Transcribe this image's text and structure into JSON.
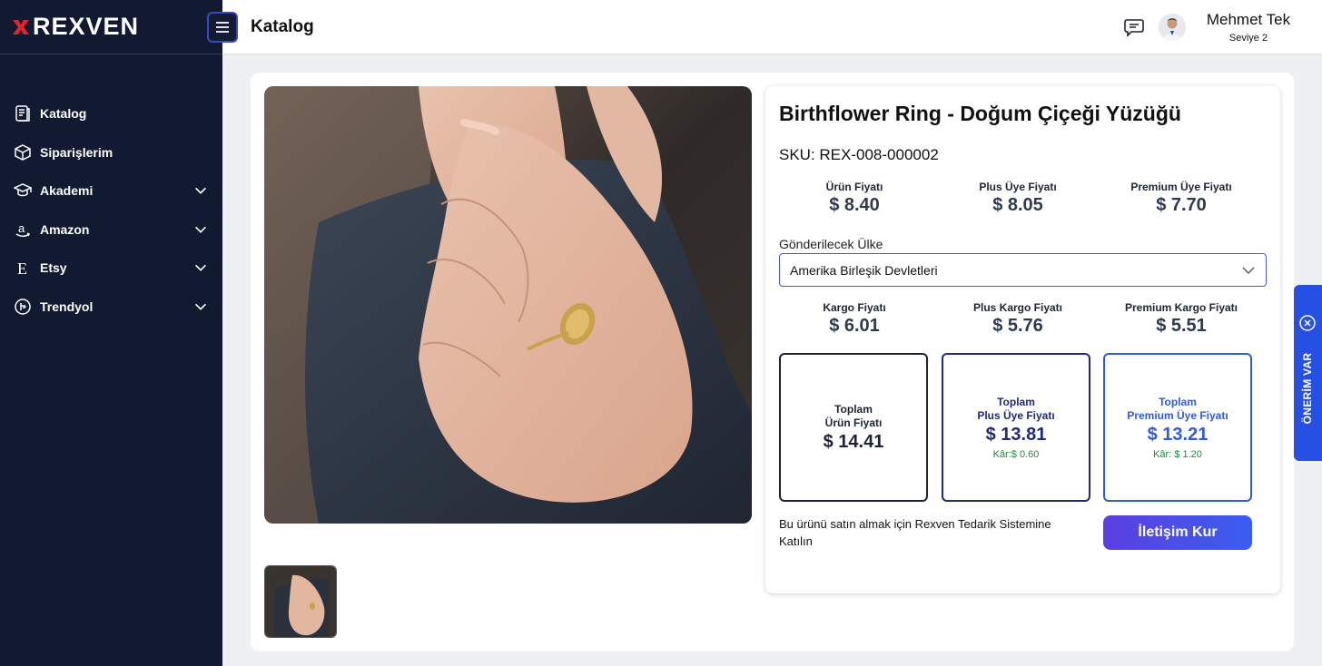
{
  "brand": {
    "name": "REXVEN"
  },
  "sidebar": {
    "items": [
      {
        "label": "Katalog",
        "icon": "catalog-icon",
        "expandable": false
      },
      {
        "label": "Siparişlerim",
        "icon": "box-icon",
        "expandable": false
      },
      {
        "label": "Akademi",
        "icon": "graduation-cap-icon",
        "expandable": true
      },
      {
        "label": "Amazon",
        "icon": "amazon-icon",
        "expandable": true
      },
      {
        "label": "Etsy",
        "icon": "etsy-icon",
        "expandable": true
      },
      {
        "label": "Trendyol",
        "icon": "trendyol-icon",
        "expandable": true
      }
    ]
  },
  "header": {
    "title": "Katalog",
    "user": {
      "name": "Mehmet Tek",
      "level": "Seviye 2"
    }
  },
  "product": {
    "title": "Birthflower Ring - Doğum Çiçeği Yüzüğü",
    "sku": "SKU: REX-008-000002",
    "prices": [
      {
        "label": "Ürün Fiyatı",
        "value": "$ 8.40"
      },
      {
        "label": "Plus Üye Fiyatı",
        "value": "$ 8.05"
      },
      {
        "label": "Premium Üye Fiyatı",
        "value": "$ 7.70"
      }
    ],
    "country_label": "Gönderilecek Ülke",
    "country_selected": "Amerika Birleşik Devletleri",
    "shipping": [
      {
        "label": "Kargo Fiyatı",
        "value": "$ 6.01"
      },
      {
        "label": "Plus Kargo Fiyatı",
        "value": "$ 5.76"
      },
      {
        "label": "Premium Kargo Fiyatı",
        "value": "$ 5.51"
      }
    ],
    "totals": [
      {
        "line1": "Toplam",
        "line2": "Ürün Fiyatı",
        "value": "$ 14.41",
        "profit": ""
      },
      {
        "line1": "Toplam",
        "line2": "Plus Üye Fiyatı",
        "value": "$ 13.81",
        "profit": "Kâr:$ 0.60"
      },
      {
        "line1": "Toplam",
        "line2": "Premium Üye Fiyatı",
        "value": "$ 13.21",
        "profit": "Kâr: $ 1.20"
      }
    ],
    "join_text": "Bu ürünü satın almak için Rexven Tedarik Sistemine Katılın",
    "contact_button": "İletişim Kur"
  },
  "suggestion_tab": {
    "label": "ÖNERİM VAR"
  },
  "colors": {
    "sidebar_bg": "#111a30",
    "accent_blue": "#2f5be0",
    "navy": "#1f2a7a",
    "profit_green": "#1e8a3c",
    "brand_red": "#e3242b"
  }
}
